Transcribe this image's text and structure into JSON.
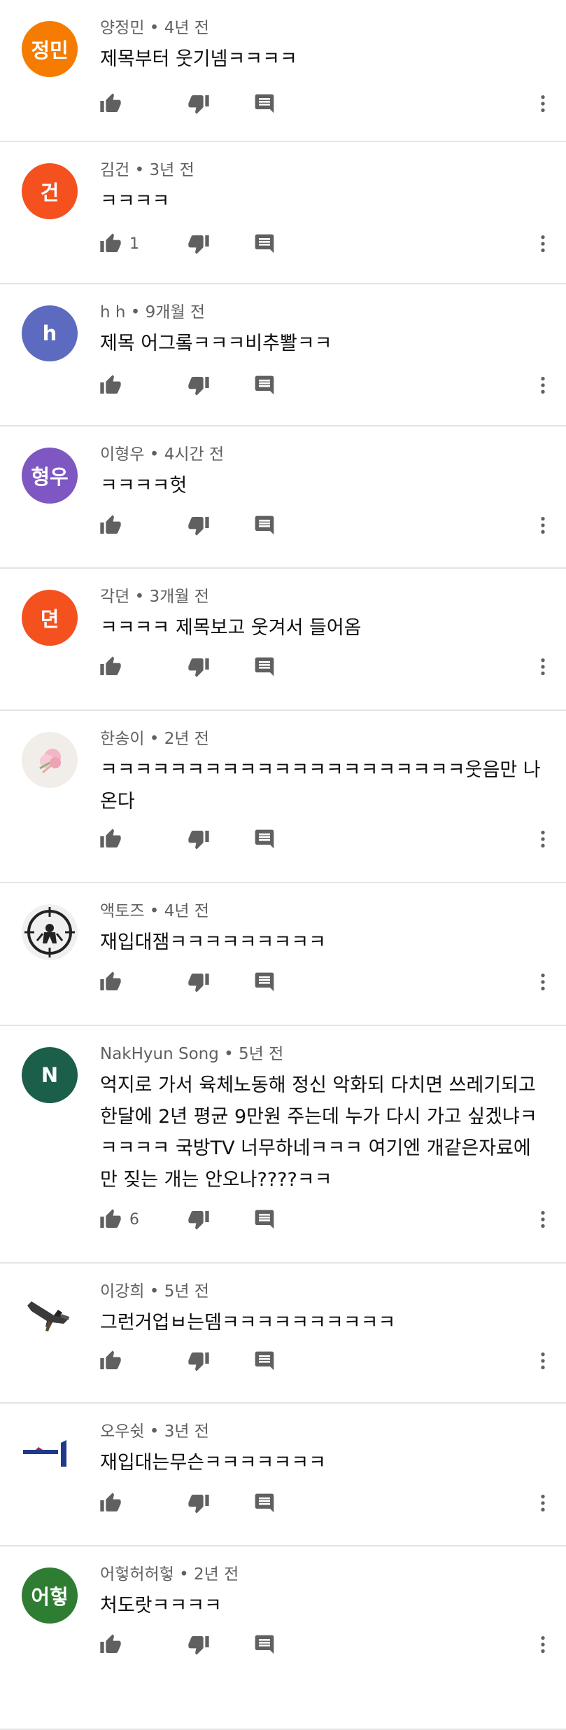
{
  "colors": {
    "meta": "#606060",
    "text": "#0f0f0f",
    "icon": "#606060",
    "divider": "#e4e4e4"
  },
  "comments": [
    {
      "author": "양정민",
      "time": "4년 전",
      "text": "제목부터 웃기넴ㅋㅋㅋㅋ",
      "likes": "",
      "avatar": {
        "type": "letter",
        "letter": "정민",
        "color": "#f57c00"
      }
    },
    {
      "author": "김건",
      "time": "3년 전",
      "text": "ㅋㅋㅋㅋ",
      "likes": "1",
      "avatar": {
        "type": "letter",
        "letter": "건",
        "color": "#f4511e"
      }
    },
    {
      "author": "h h",
      "time": "9개월 전",
      "text": "제목 어그롴ㅋㅋㅋ비추뽤ㅋㅋ",
      "likes": "",
      "avatar": {
        "type": "letter",
        "letter": "h",
        "color": "#5c6bc0"
      }
    },
    {
      "author": "이형우",
      "time": "4시간 전",
      "text": "ㅋㅋㅋㅋ헛",
      "likes": "",
      "avatar": {
        "type": "letter",
        "letter": "형우",
        "color": "#7e57c2"
      }
    },
    {
      "author": "각뎐",
      "time": "3개월 전",
      "text": "ㅋㅋㅋㅋ 제목보고 웃겨서 들어옴",
      "likes": "",
      "avatar": {
        "type": "letter",
        "letter": "뎐",
        "color": "#f4511e"
      }
    },
    {
      "author": "한송이",
      "time": "2년 전",
      "text": "ㅋㅋㅋㅋㅋㅋㅋㅋㅋㅋㅋㅋㅋㅋㅋㅋㅋㅋㅋㅋㅋ웃음만 나온다",
      "likes": "",
      "avatar": {
        "type": "flower"
      }
    },
    {
      "author": "액토즈",
      "time": "4년 전",
      "text": "재입대잼ㅋㅋㅋㅋㅋㅋㅋㅋㅋ",
      "likes": "",
      "avatar": {
        "type": "target"
      }
    },
    {
      "author": "NakHyun Song",
      "time": "5년 전",
      "text": "억지로 가서 육체노동해 정신 악화되 다치면 쓰레기되고 한달에 2년 평균 9만원 주는데 누가 다시 가고 싶겠냐ㅋㅋㅋㅋㅋ 국방TV 너무하네ㅋㅋㅋ 여기엔 개같은자료에만 짖는 개는 안오나????ㅋㅋ",
      "likes": "6",
      "avatar": {
        "type": "letter",
        "letter": "N",
        "color": "#1b5e4a"
      }
    },
    {
      "author": "이강희",
      "time": "5년 전",
      "text": "그런거업ㅂ는뎀ㅋㅋㅋㅋㅋㅋㅋㅋㅋㅋ",
      "likes": "",
      "avatar": {
        "type": "gun"
      }
    },
    {
      "author": "오우쉿",
      "time": "3년 전",
      "text": "재입대는무슨ㅋㅋㅋㅋㅋㅋㅋ",
      "likes": "",
      "avatar": {
        "type": "logo"
      }
    },
    {
      "author": "어헣허허헣",
      "time": "2년 전",
      "text": "처도랏ㅋㅋㅋㅋ",
      "likes": "",
      "avatar": {
        "type": "letter",
        "letter": "어헣",
        "color": "#2e7d32"
      }
    }
  ]
}
